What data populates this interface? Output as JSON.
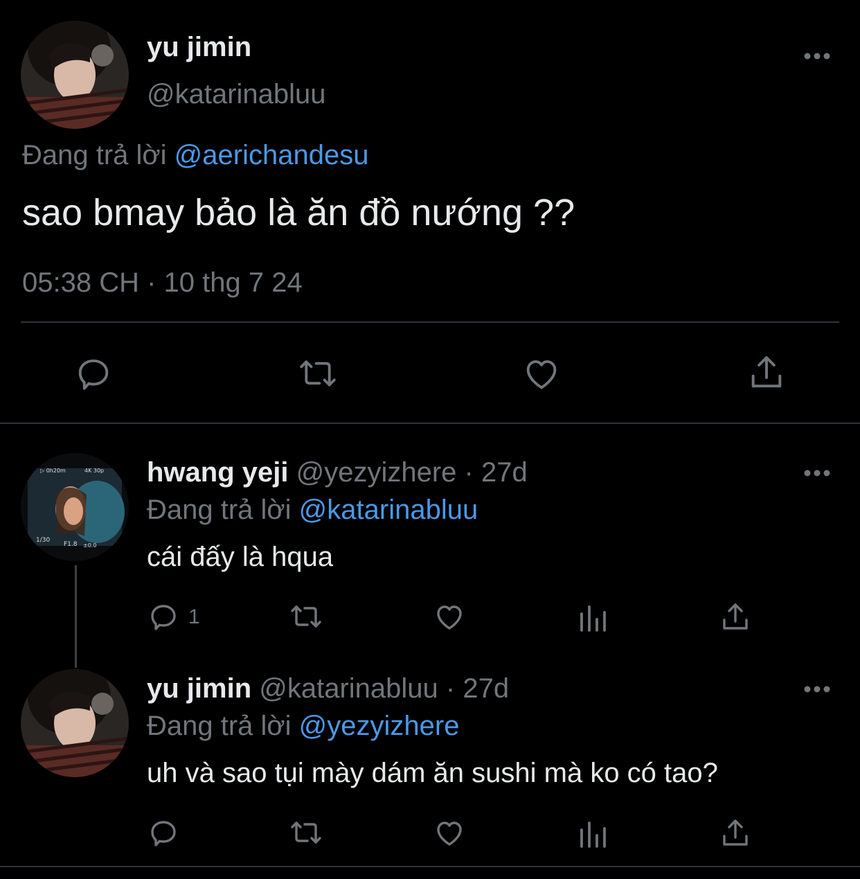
{
  "main_tweet": {
    "name": "yu jimin",
    "handle": "@katarinabluu",
    "reply_prefix": "Đang trả lời",
    "reply_to": "@aerichandesu",
    "text": "sao bmay bảo là ăn đồ nướng ??",
    "timestamp": "05:38 CH · 10 thg 7 24"
  },
  "replies": [
    {
      "name": "hwang yeji",
      "handle_time": "@yezyizhere · 27d",
      "reply_prefix": "Đang trả lời",
      "reply_to": "@katarinabluu",
      "text": "cái đấy là hqua",
      "reply_count": "1"
    },
    {
      "name": "yu jimin",
      "handle_time": "@katarinabluu · 27d",
      "reply_prefix": "Đang trả lời",
      "reply_to": "@yezyizhere",
      "text": "uh và sao tụi mày dám ăn sushi mà ko có tao?"
    }
  ],
  "icons": [
    "more-icon",
    "reply-icon",
    "retweet-icon",
    "like-icon",
    "share-icon",
    "views-icon"
  ],
  "colors": {
    "background": "#000000",
    "text": "#e7e9ea",
    "muted": "#71767b",
    "link": "#4a99e9",
    "divider": "#2f3336"
  }
}
